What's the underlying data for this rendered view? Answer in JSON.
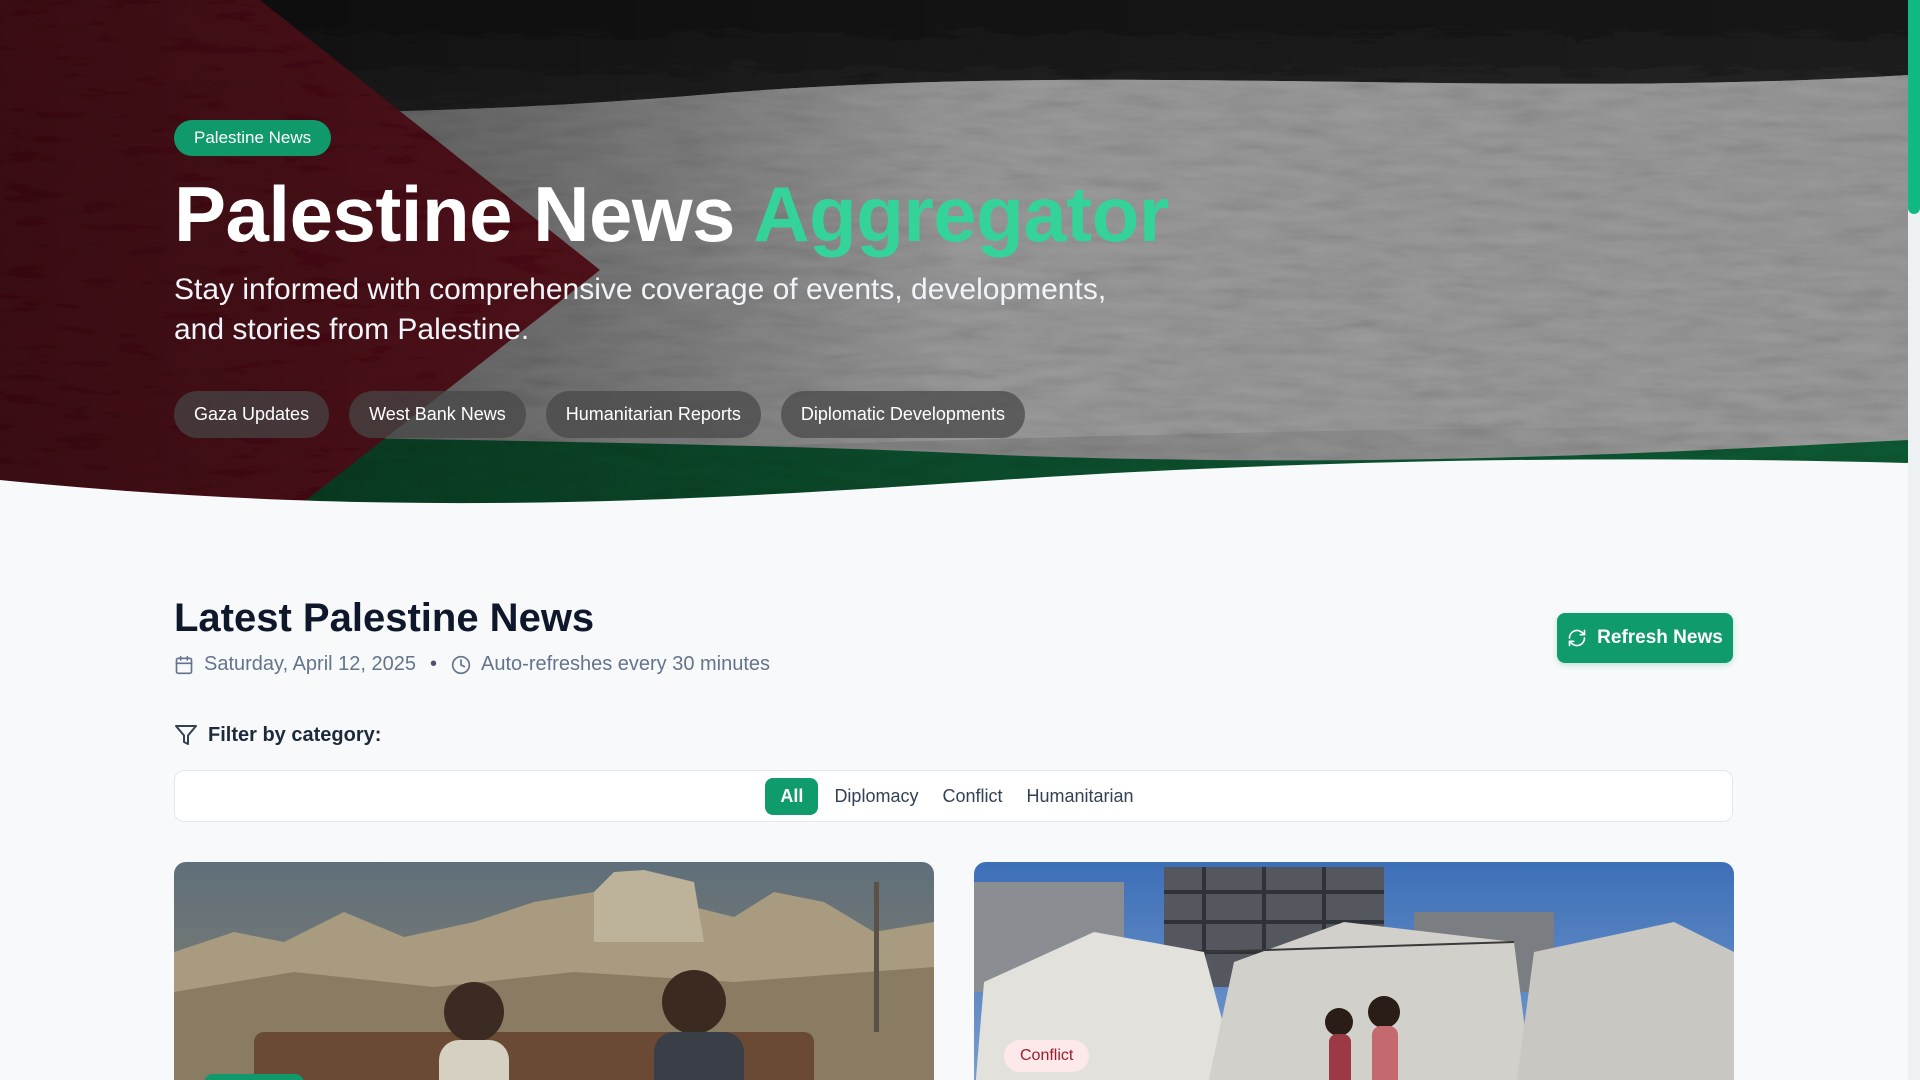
{
  "hero": {
    "badge": "Palestine News",
    "title_main": "Palestine News ",
    "title_accent": "Aggregator",
    "subtitle": "Stay informed with comprehensive coverage of events, developments, and stories from Palestine.",
    "tags": [
      "Gaza Updates",
      "West Bank News",
      "Humanitarian Reports",
      "Diplomatic Developments"
    ]
  },
  "main": {
    "title": "Latest Palestine News",
    "date": "Saturday, April 12, 2025",
    "separator": "•",
    "refresh_note": "Auto-refreshes every 30 minutes",
    "refresh_button": "Refresh News",
    "filter_label": "Filter by category:",
    "filters": [
      {
        "label": "All",
        "active": true
      },
      {
        "label": "Diplomacy",
        "active": false
      },
      {
        "label": "Conflict",
        "active": false
      },
      {
        "label": "Humanitarian",
        "active": false
      }
    ]
  },
  "cards": [
    {
      "image": "rubble-scene-photo",
      "category": ""
    },
    {
      "image": "tent-camp-photo",
      "category": "Conflict"
    }
  ],
  "colors": {
    "accent": "#34d399",
    "primary_button": "#0f9b6c",
    "flag_red": "#7a1424",
    "flag_green": "#0f6b3a",
    "conflict_badge_bg": "#fde8ea",
    "conflict_badge_text": "#9b1c2c"
  }
}
